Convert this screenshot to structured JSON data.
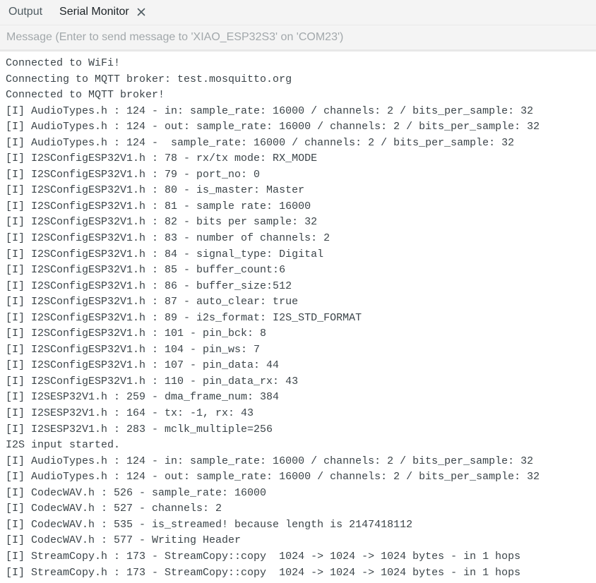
{
  "tabs": [
    {
      "label": "Output",
      "active": false
    },
    {
      "label": "Serial Monitor",
      "active": true
    }
  ],
  "icons": {
    "close": "close-icon"
  },
  "message_input": {
    "placeholder": "Message (Enter to send message to 'XIAO_ESP32S3' on 'COM23')",
    "value": ""
  },
  "console_lines": [
    "Connected to WiFi!",
    "Connecting to MQTT broker: test.mosquitto.org",
    "Connected to MQTT broker!",
    "[I] AudioTypes.h : 124 - in: sample_rate: 16000 / channels: 2 / bits_per_sample: 32",
    "[I] AudioTypes.h : 124 - out: sample_rate: 16000 / channels: 2 / bits_per_sample: 32",
    "[I] AudioTypes.h : 124 -  sample_rate: 16000 / channels: 2 / bits_per_sample: 32",
    "[I] I2SConfigESP32V1.h : 78 - rx/tx mode: RX_MODE",
    "[I] I2SConfigESP32V1.h : 79 - port_no: 0",
    "[I] I2SConfigESP32V1.h : 80 - is_master: Master",
    "[I] I2SConfigESP32V1.h : 81 - sample rate: 16000",
    "[I] I2SConfigESP32V1.h : 82 - bits per sample: 32",
    "[I] I2SConfigESP32V1.h : 83 - number of channels: 2",
    "[I] I2SConfigESP32V1.h : 84 - signal_type: Digital",
    "[I] I2SConfigESP32V1.h : 85 - buffer_count:6",
    "[I] I2SConfigESP32V1.h : 86 - buffer_size:512",
    "[I] I2SConfigESP32V1.h : 87 - auto_clear: true",
    "[I] I2SConfigESP32V1.h : 89 - i2s_format: I2S_STD_FORMAT",
    "[I] I2SConfigESP32V1.h : 101 - pin_bck: 8",
    "[I] I2SConfigESP32V1.h : 104 - pin_ws: 7",
    "[I] I2SConfigESP32V1.h : 107 - pin_data: 44",
    "[I] I2SConfigESP32V1.h : 110 - pin_data_rx: 43",
    "[I] I2SESP32V1.h : 259 - dma_frame_num: 384",
    "[I] I2SESP32V1.h : 164 - tx: -1, rx: 43",
    "[I] I2SESP32V1.h : 283 - mclk_multiple=256",
    "I2S input started.",
    "[I] AudioTypes.h : 124 - in: sample_rate: 16000 / channels: 2 / bits_per_sample: 32",
    "[I] AudioTypes.h : 124 - out: sample_rate: 16000 / channels: 2 / bits_per_sample: 32",
    "[I] CodecWAV.h : 526 - sample_rate: 16000",
    "[I] CodecWAV.h : 527 - channels: 2",
    "[I] CodecWAV.h : 535 - is_streamed! because length is 2147418112",
    "[I] CodecWAV.h : 577 - Writing Header",
    "[I] StreamCopy.h : 173 - StreamCopy::copy  1024 -> 1024 -> 1024 bytes - in 1 hops",
    "[I] StreamCopy.h : 173 - StreamCopy::copy  1024 -> 1024 -> 1024 bytes - in 1 hops"
  ]
}
